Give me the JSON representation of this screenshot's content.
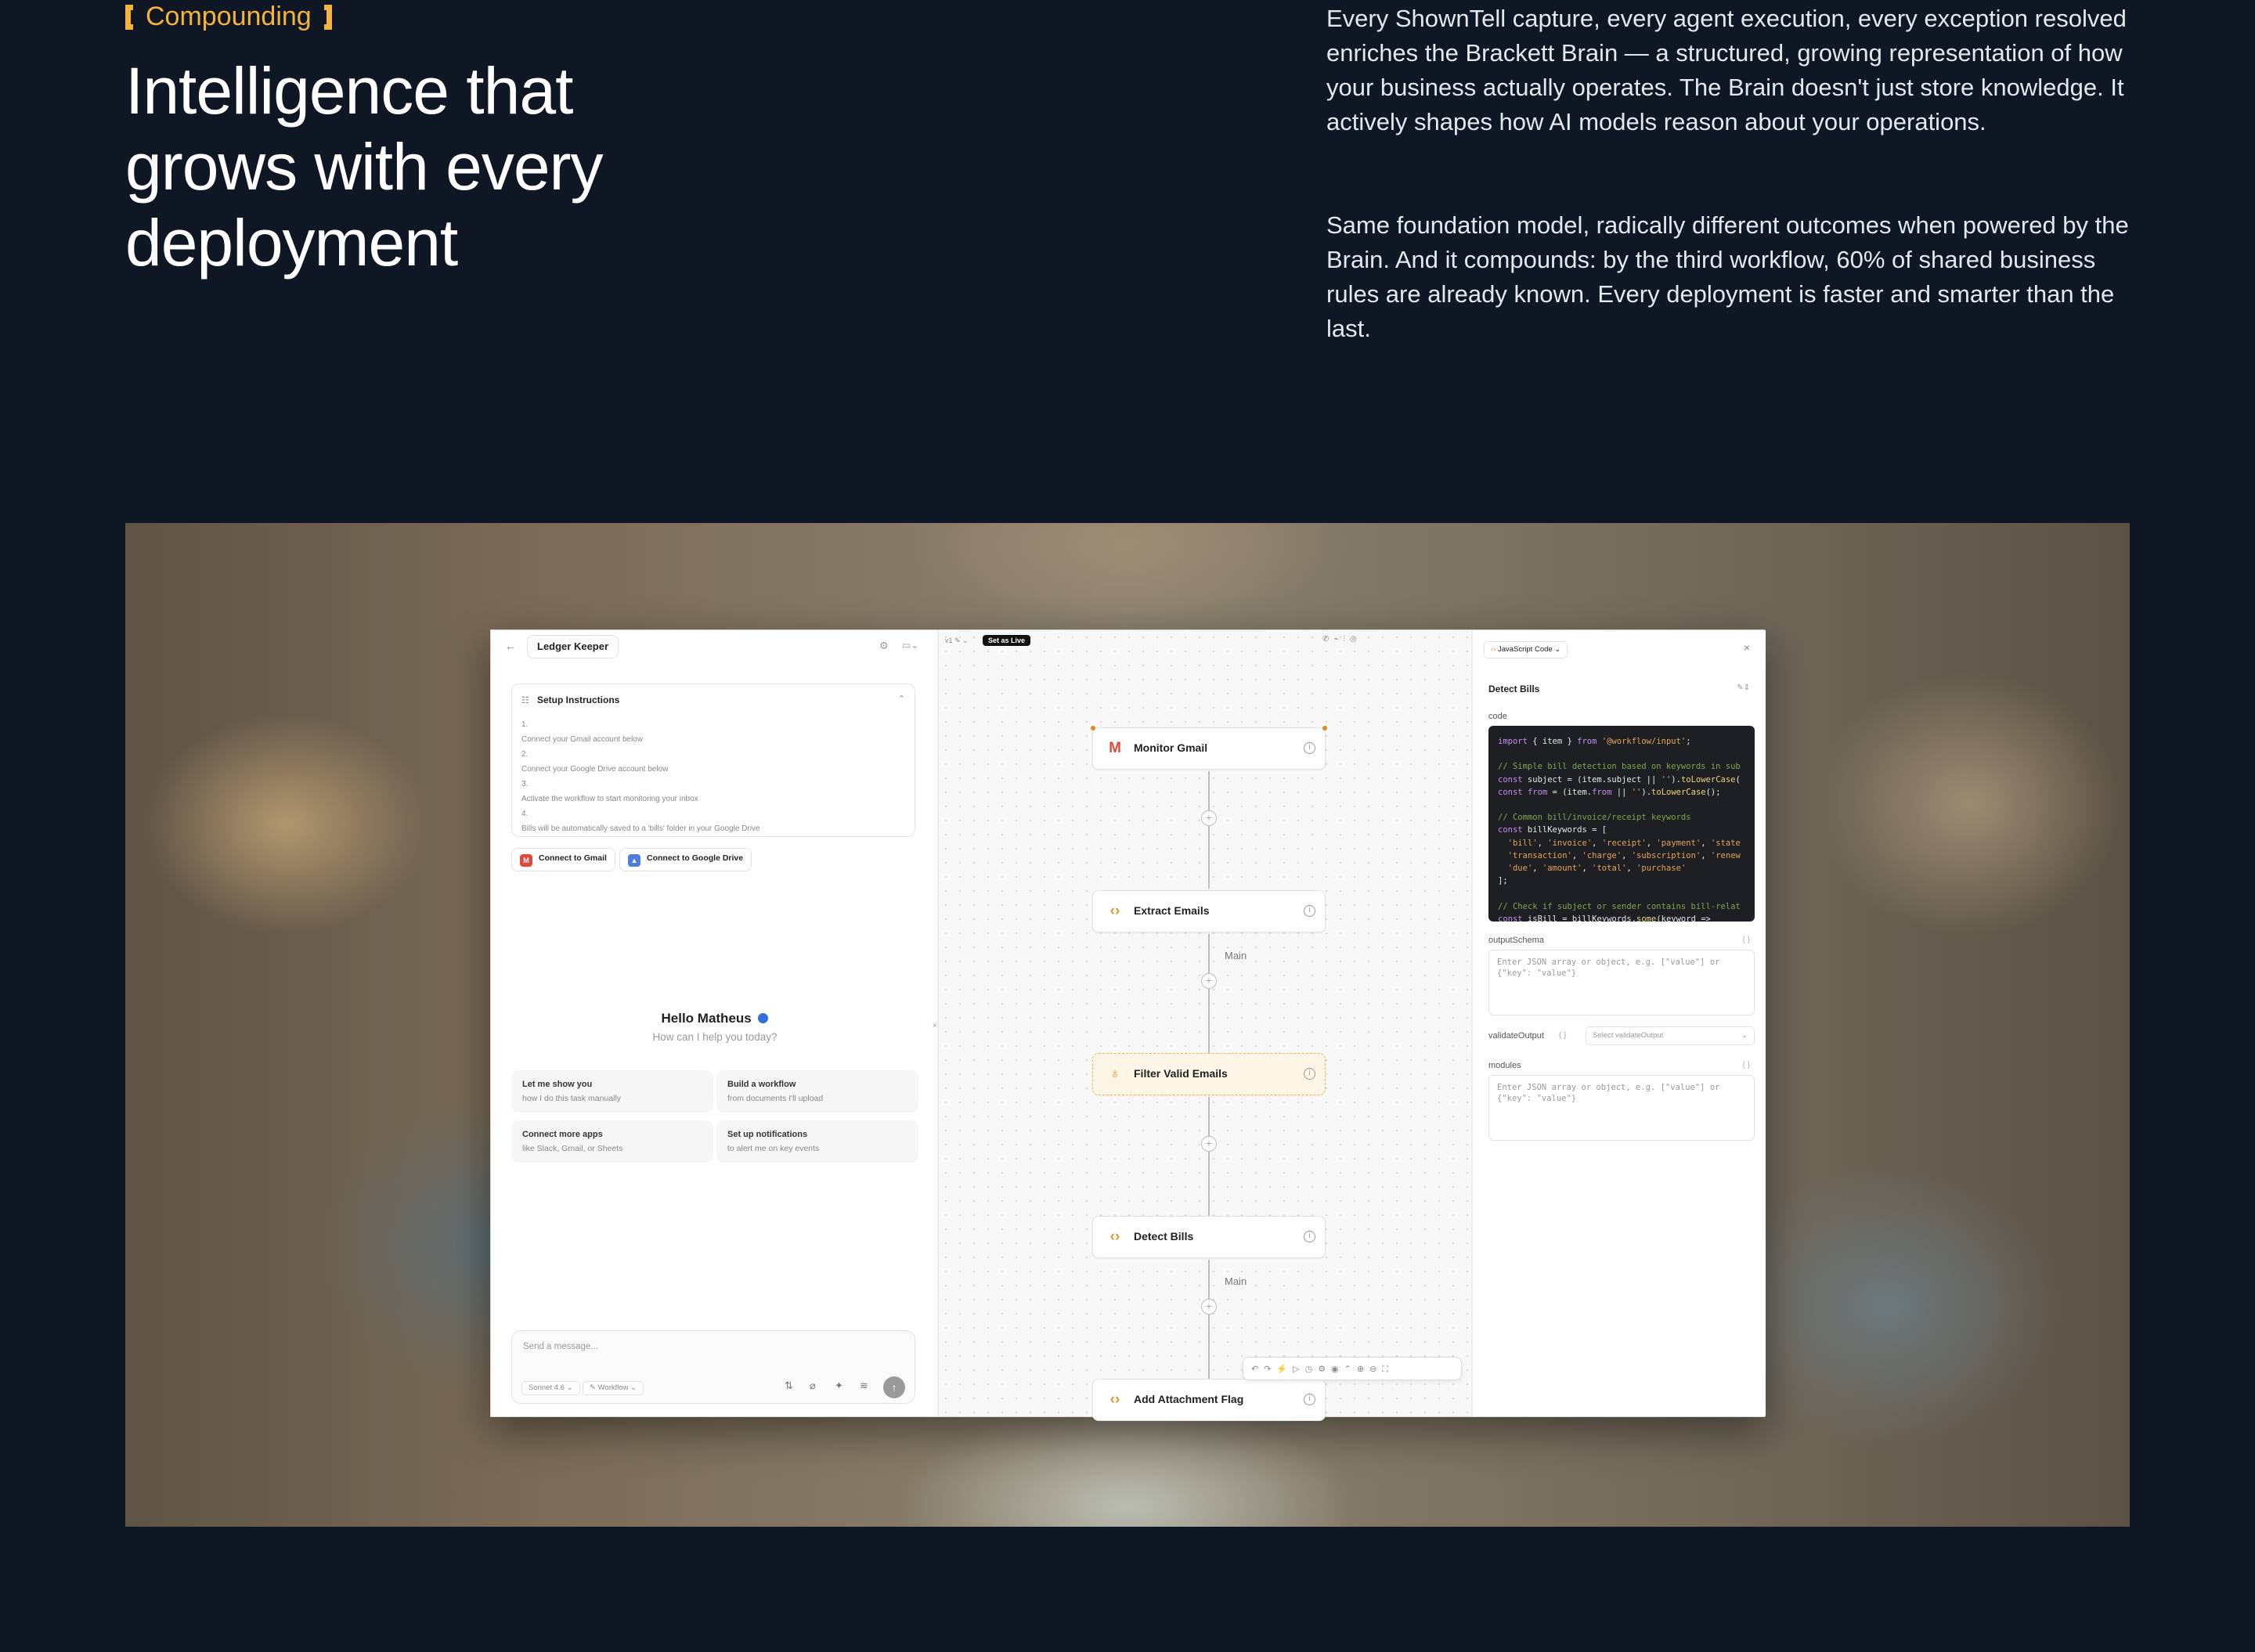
{
  "hero": {
    "eyebrow": "Compounding",
    "headline_1": "Intelligence that",
    "headline_2": "grows with every",
    "headline_3": "deployment",
    "para1": "Every ShownTell capture, every agent execution, every exception resolved enriches the Brackett Brain — a structured, growing representation of how your business actually operates. The Brain doesn't just store knowledge. It actively shapes how AI models reason about your operations.",
    "para2": "Same foundation model, radically different outcomes when powered by the Brain. And it compounds: by the third workflow, 60% of shared business rules are already known. Every deployment is faster and smarter than the last."
  },
  "app": {
    "agent_name": "Ledger Keeper",
    "setup": {
      "title": "Setup Instructions",
      "steps": [
        {
          "n": "1.",
          "text": "Connect your Gmail account below"
        },
        {
          "n": "2.",
          "text": "Connect your Google Drive account below"
        },
        {
          "n": "3.",
          "text": "Activate the workflow to start monitoring your inbox"
        },
        {
          "n": "4.",
          "text": "Bills will be automatically saved to a 'bills' folder in your Google Drive"
        }
      ],
      "connect_gmail": "Connect to Gmail",
      "connect_drive": "Connect to Google Drive"
    },
    "greeting": "Hello Matheus",
    "subgreeting": "How can I help you today?",
    "suggestions": [
      {
        "title": "Let me show you",
        "sub": "how I do this task manually"
      },
      {
        "title": "Build a workflow",
        "sub": "from documents I'll upload"
      },
      {
        "title": "Connect more apps",
        "sub": "like Slack, Gmail, or Sheets"
      },
      {
        "title": "Set up notifications",
        "sub": "to alert me on key events"
      }
    ],
    "composer": {
      "placeholder": "Send a message...",
      "model": "Sonnet 4.6",
      "mode": "Workflow"
    },
    "canvas": {
      "version": "v1",
      "live_button": "Set as Live",
      "nodes": [
        "Monitor Gmail",
        "Extract Emails",
        "Filter Valid Emails",
        "Detect Bills",
        "Add Attachment Flag"
      ],
      "edge_label": "Main"
    },
    "inspector": {
      "node_type": "JavaScript Code",
      "node_name": "Detect Bills",
      "code_label": "code",
      "code_lines": [
        "import { item } from '@workflow/input';",
        "",
        "// Simple bill detection based on keywords in sub",
        "const subject = (item.subject || '').toLowerCase(",
        "const from = (item.from || '').toLowerCase();",
        "",
        "// Common bill/invoice/receipt keywords",
        "const billKeywords = [",
        "  'bill', 'invoice', 'receipt', 'payment', 'state",
        "  'transaction', 'charge', 'subscription', 'renew",
        "  'due', 'amount', 'total', 'purchase'",
        "];",
        "",
        "// Check if subject or sender contains bill-relat",
        "const isBill = billKeywords.some(keyword =>"
      ],
      "output_schema_label": "outputSchema",
      "json_placeholder": "Enter JSON array or object, e.g. [\"value\"] or {\"key\": \"value\"}",
      "validate_label": "validateOutput",
      "validate_select": "Select validateOutput",
      "modules_label": "modules",
      "braces": "{ }"
    }
  }
}
